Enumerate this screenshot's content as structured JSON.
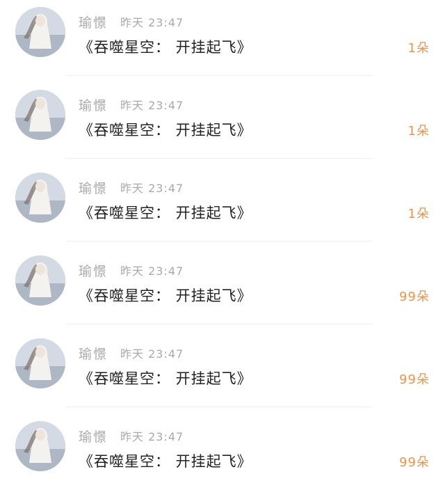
{
  "colors": {
    "meta_text": "#a9a9a9",
    "title_text": "#222222",
    "count_text": "#f0924a",
    "divider": "#eeeeee"
  },
  "messages": [
    {
      "username": "瑜憬",
      "time": "昨天 23:47",
      "title": "《吞噬星空： 开挂起飞》",
      "count": "1朵"
    },
    {
      "username": "瑜憬",
      "time": "昨天 23:47",
      "title": "《吞噬星空： 开挂起飞》",
      "count": "1朵"
    },
    {
      "username": "瑜憬",
      "time": "昨天 23:47",
      "title": "《吞噬星空： 开挂起飞》",
      "count": "1朵"
    },
    {
      "username": "瑜憬",
      "time": "昨天 23:47",
      "title": "《吞噬星空： 开挂起飞》",
      "count": "99朵"
    },
    {
      "username": "瑜憬",
      "time": "昨天 23:47",
      "title": "《吞噬星空： 开挂起飞》",
      "count": "99朵"
    },
    {
      "username": "瑜憬",
      "time": "昨天 23:47",
      "title": "《吞噬星空： 开挂起飞》",
      "count": "99朵"
    }
  ]
}
